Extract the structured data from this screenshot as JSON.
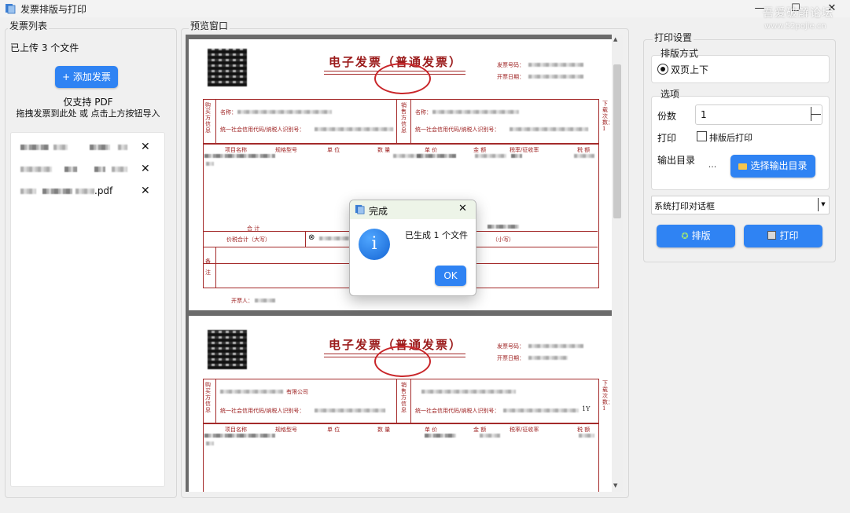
{
  "window": {
    "title": "发票排版与打印",
    "controls": [
      "minimize-icon",
      "maximize-icon",
      "close-icon"
    ],
    "watermark": "吾爱破解论坛",
    "watermark_url": "www.52pojie.cn"
  },
  "left": {
    "group_title": "发票列表",
    "uploaded_text": "已上传 3 个文件",
    "add_button": "+ 添加发票",
    "hint_line1": "仅支持 PDF",
    "hint_line2": "拖拽发票到此处 或 点击上方按钮导入",
    "files": [
      {
        "name": "",
        "remove": "✕"
      },
      {
        "name": "",
        "remove": "✕"
      },
      {
        "name": ".pdf",
        "remove": "✕"
      }
    ]
  },
  "preview": {
    "group_title": "预览窗口",
    "invoice": {
      "title": "电子发票（普通发票）",
      "labels": {
        "number": "发票号码：",
        "date": "开票日期：",
        "buyer": "购买方信息",
        "seller": "销售方信息",
        "name": "名称：",
        "tax_id": "统一社会信用代码/纳税人识别号：",
        "item_name": "项目名称",
        "spec": "规格型号",
        "unit": "单 位",
        "qty": "数 量",
        "price": "单 价",
        "amount": "金 额",
        "tax_rate": "税率/征收率",
        "tax": "税 额",
        "total": "合 计",
        "total_words": "价税合计（大写）",
        "lower": "（小写）",
        "remark": "备 注",
        "issuer": "开票人：",
        "side": "下载次数：1"
      },
      "second_company": "有限公司",
      "second_tax_suffix": "1Y"
    }
  },
  "right": {
    "group_title": "打印设置",
    "layout_group": "排版方式",
    "layout_option": "双页上下",
    "options_group": "选项",
    "copies_label": "份数",
    "copies_value": "1",
    "print_label": "打印",
    "print_after_label": "排版后打印",
    "output_label": "输出目录",
    "browse_dots": "...",
    "choose_dir_button": "选择输出目录",
    "printer_select": "系统打印对话框",
    "layout_button": "排版",
    "print_button": "打印"
  },
  "dialog": {
    "title": "完成",
    "message": "已生成 1 个文件",
    "ok": "OK",
    "info_glyph": "i"
  },
  "colors": {
    "accent": "#2f83f3",
    "invoice_red": "#a42a2a",
    "stamp_red": "#c9262a"
  }
}
